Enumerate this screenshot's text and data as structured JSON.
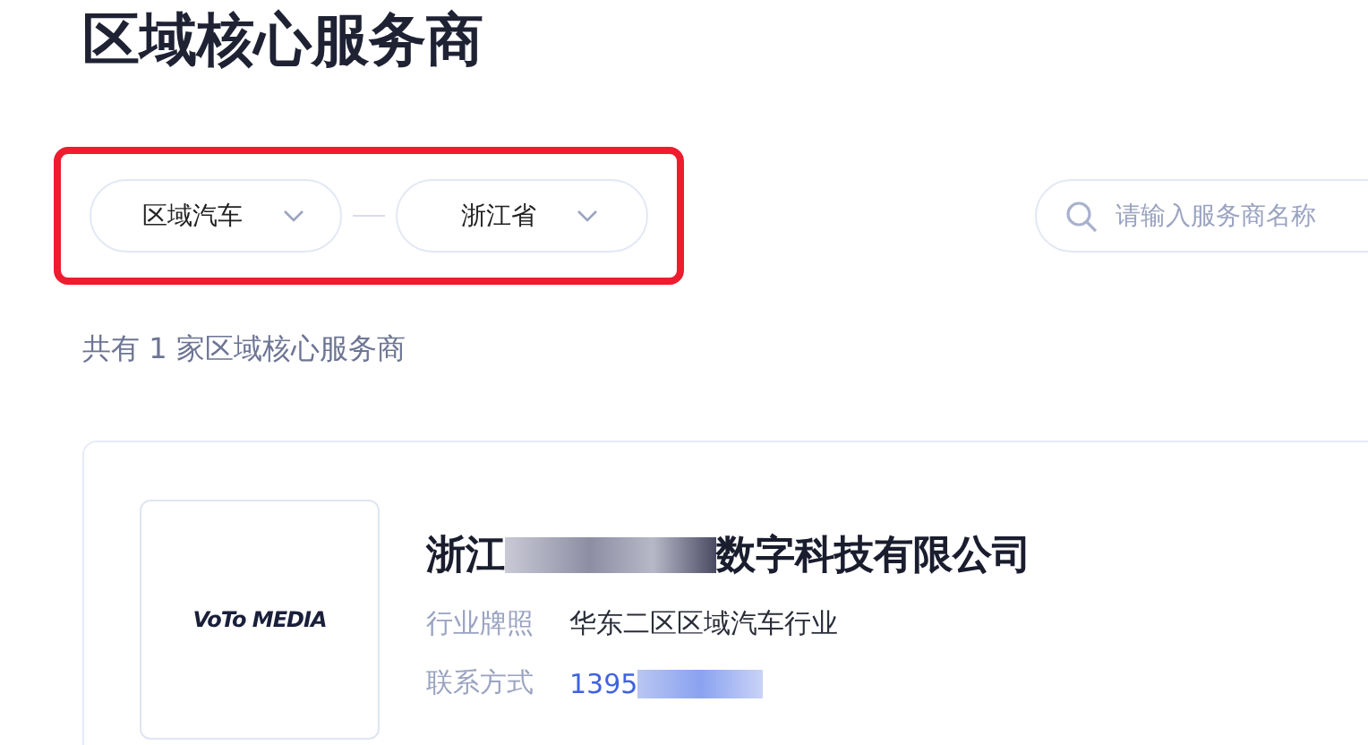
{
  "page_title": "区域核心服务商",
  "filters": [
    {
      "kind": "select",
      "value": "区域汽车"
    },
    {
      "kind": "select",
      "value": "浙江省"
    }
  ],
  "search": {
    "placeholder": "请输入服务商名称"
  },
  "highlight": {
    "on": true
  },
  "result_count": "共有 1 家区域核心服务商",
  "providers": [
    {
      "logo": "VoTo MEDIA",
      "name_start": "浙江",
      "name_end": "数字科技有限公司",
      "fields": [
        {
          "label": "行业牌照",
          "value": "华东二区区域汽车行业",
          "kind": "text"
        },
        {
          "label": "联系方式",
          "value": "1395",
          "kind": "phone"
        }
      ]
    }
  ]
}
